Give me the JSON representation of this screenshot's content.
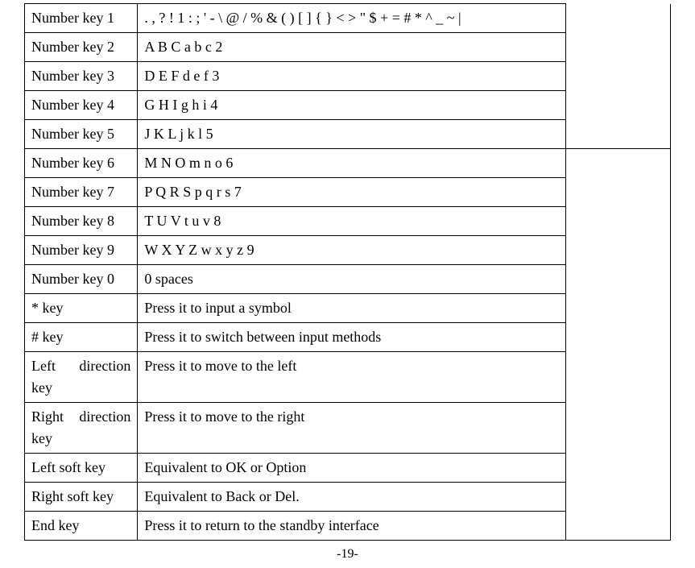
{
  "rows_group1": [
    {
      "key": "Number key 1",
      "desc": ". , ? ! 1 : ; ' - \\ @ / % & ( ) [ ] { } < > \" $ + = # * ^ _ ~ |"
    },
    {
      "key": "Number key 2",
      "desc": "A B C a b c 2"
    },
    {
      "key": "Number key 3",
      "desc": "D E F d e f 3"
    },
    {
      "key": "Number key 4",
      "desc": "G H I g h i 4"
    },
    {
      "key": "Number key 5",
      "desc": "J K L j k l 5"
    }
  ],
  "rows_group2": [
    {
      "key": "Number key 6",
      "desc": "M N O m n o 6"
    },
    {
      "key": "Number key 7",
      "desc": "P Q R S p q r s 7"
    },
    {
      "key": "Number key 8",
      "desc": "T U V t u v 8"
    },
    {
      "key": "Number key 9",
      "desc": "W X Y Z w x y z 9"
    },
    {
      "key": "Number key 0",
      "desc": "  0 spaces"
    },
    {
      "key": "* key",
      "desc": "Press it to input a symbol"
    },
    {
      "key": "# key",
      "desc": "Press it to switch between input methods"
    },
    {
      "key": "Left direction key",
      "desc": "Press it to move to the left"
    },
    {
      "key": "Right direction key",
      "desc": "Press it to move to the right"
    },
    {
      "key": "Left soft key",
      "desc": "Equivalent to OK or Option"
    },
    {
      "key": "Right soft key",
      "desc": "Equivalent to Back or Del."
    },
    {
      "key": "End key",
      "desc": "Press it to return to the standby interface"
    }
  ],
  "page_number": "-19-"
}
